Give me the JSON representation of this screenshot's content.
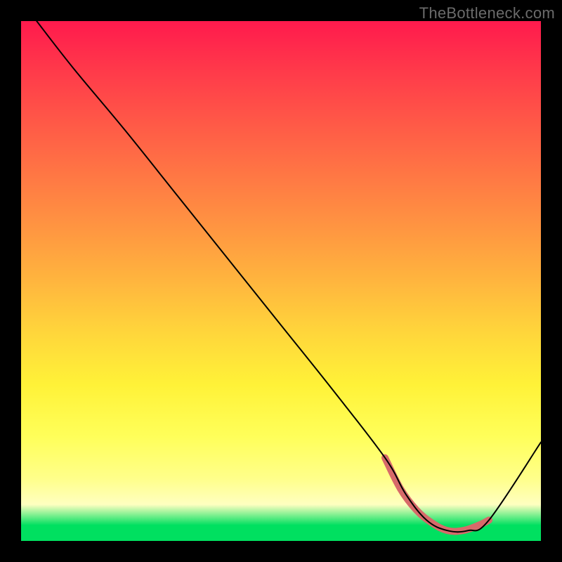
{
  "watermark": "TheBottleneck.com",
  "chart_data": {
    "type": "line",
    "title": "",
    "xlabel": "",
    "ylabel": "",
    "xlim": [
      0,
      100
    ],
    "ylim": [
      0,
      100
    ],
    "series": [
      {
        "name": "main-curve",
        "x": [
          3,
          10,
          20,
          30,
          40,
          50,
          60,
          70,
          74,
          78,
          82,
          86,
          90,
          100
        ],
        "y": [
          100,
          91,
          79,
          66.5,
          54,
          41.5,
          29,
          16,
          9,
          4,
          2,
          2,
          4,
          19
        ],
        "stroke": "#000000",
        "width": 2
      },
      {
        "name": "highlight-band",
        "x": [
          70,
          73,
          76,
          79,
          82,
          85,
          88,
          90
        ],
        "y": [
          16,
          10,
          6,
          3.5,
          2,
          2,
          3,
          4
        ],
        "stroke": "#d76a6a",
        "width": 10
      }
    ],
    "grid": false,
    "legend": false
  }
}
